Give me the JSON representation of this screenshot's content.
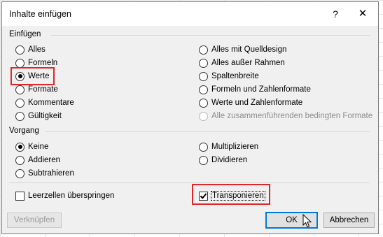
{
  "dialog": {
    "title": "Inhalte einfügen",
    "help_icon": "?",
    "close_icon": "✕"
  },
  "paste": {
    "label": "Einfügen",
    "left": [
      {
        "label": "Alles",
        "checked": false
      },
      {
        "label": "Formeln",
        "checked": false
      },
      {
        "label": "Werte",
        "checked": true
      },
      {
        "label": "Formate",
        "checked": false
      },
      {
        "label": "Kommentare",
        "checked": false
      },
      {
        "label": "Gültigkeit",
        "checked": false
      }
    ],
    "right": [
      {
        "label": "Alles mit Quelldesign",
        "checked": false
      },
      {
        "label": "Alles außer Rahmen",
        "checked": false
      },
      {
        "label": "Spaltenbreite",
        "checked": false
      },
      {
        "label": "Formeln und Zahlenformate",
        "checked": false
      },
      {
        "label": "Werte und Zahlenformate",
        "checked": false
      },
      {
        "label": "Alle zusammenführenden bedingten Formate",
        "checked": false,
        "disabled": true
      }
    ]
  },
  "operation": {
    "label": "Vorgang",
    "left": [
      {
        "label": "Keine",
        "checked": true
      },
      {
        "label": "Addieren",
        "checked": false
      },
      {
        "label": "Subtrahieren",
        "checked": false
      }
    ],
    "right": [
      {
        "label": "Multiplizieren",
        "checked": false
      },
      {
        "label": "Dividieren",
        "checked": false
      }
    ]
  },
  "checkboxes": {
    "skip_blanks": {
      "label": "Leerzellen überspringen",
      "checked": false
    },
    "transpose": {
      "label": "Transponieren",
      "checked": true
    }
  },
  "buttons": {
    "link": "Verknüpfen",
    "ok": "OK",
    "cancel": "Abbrechen"
  },
  "colors": {
    "highlight": "#e0262b",
    "default_button_border": "#0078d7"
  }
}
